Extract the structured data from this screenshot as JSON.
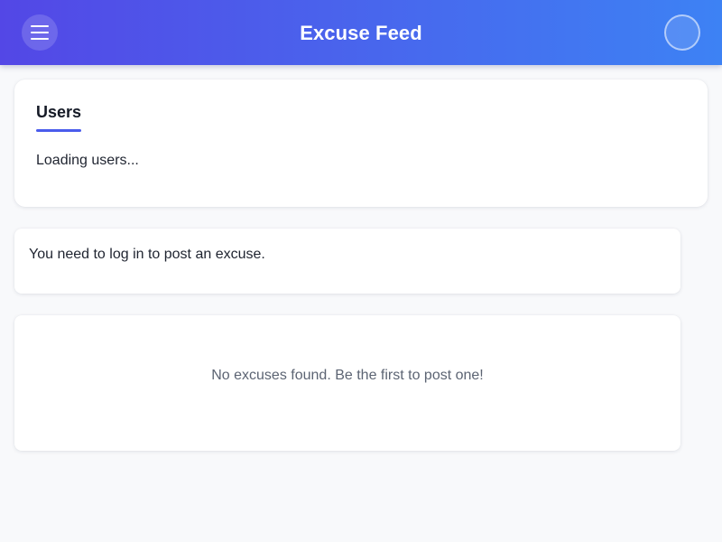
{
  "header": {
    "title": "Excuse Feed",
    "menu_icon": "hamburger-menu-icon",
    "avatar_icon": "user-avatar-icon",
    "gradient_start": "#5347e6",
    "gradient_end": "#3d82f4"
  },
  "users_panel": {
    "heading": "Users",
    "status": "Loading users...",
    "accent_color": "#4a5cec"
  },
  "post_panel": {
    "message": "You need to log in to post an excuse."
  },
  "feed": {
    "empty_message": "No excuses found. Be the first to post one!"
  }
}
